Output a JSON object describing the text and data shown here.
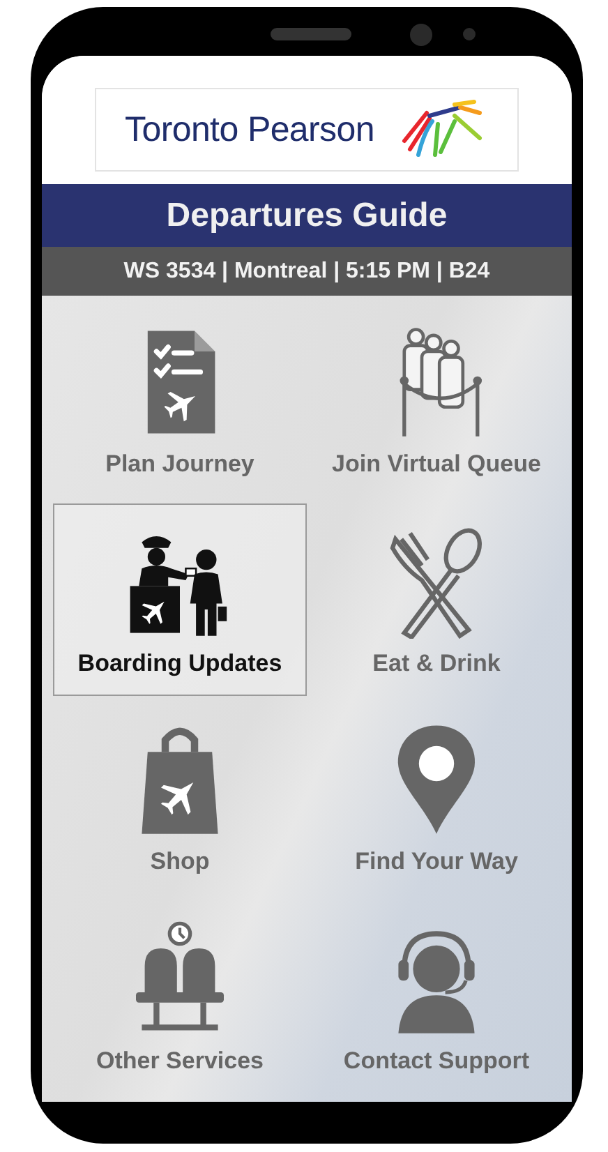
{
  "logo": {
    "text": "Toronto Pearson"
  },
  "title": "Departures Guide",
  "flight_info": "WS 3534 | Montreal | 5:15 PM | B24",
  "tiles": [
    {
      "label": "Plan Journey",
      "kind": "checklist",
      "selected": false
    },
    {
      "label": "Join Virtual Queue",
      "kind": "queue",
      "selected": false
    },
    {
      "label": "Boarding Updates",
      "kind": "boarding",
      "selected": true
    },
    {
      "label": "Eat & Drink",
      "kind": "dining",
      "selected": false
    },
    {
      "label": "Shop",
      "kind": "shop",
      "selected": false
    },
    {
      "label": "Find Your Way",
      "kind": "location",
      "selected": false
    },
    {
      "label": "Other Services",
      "kind": "services",
      "selected": false
    },
    {
      "label": "Contact Support",
      "kind": "support",
      "selected": false
    }
  ]
}
